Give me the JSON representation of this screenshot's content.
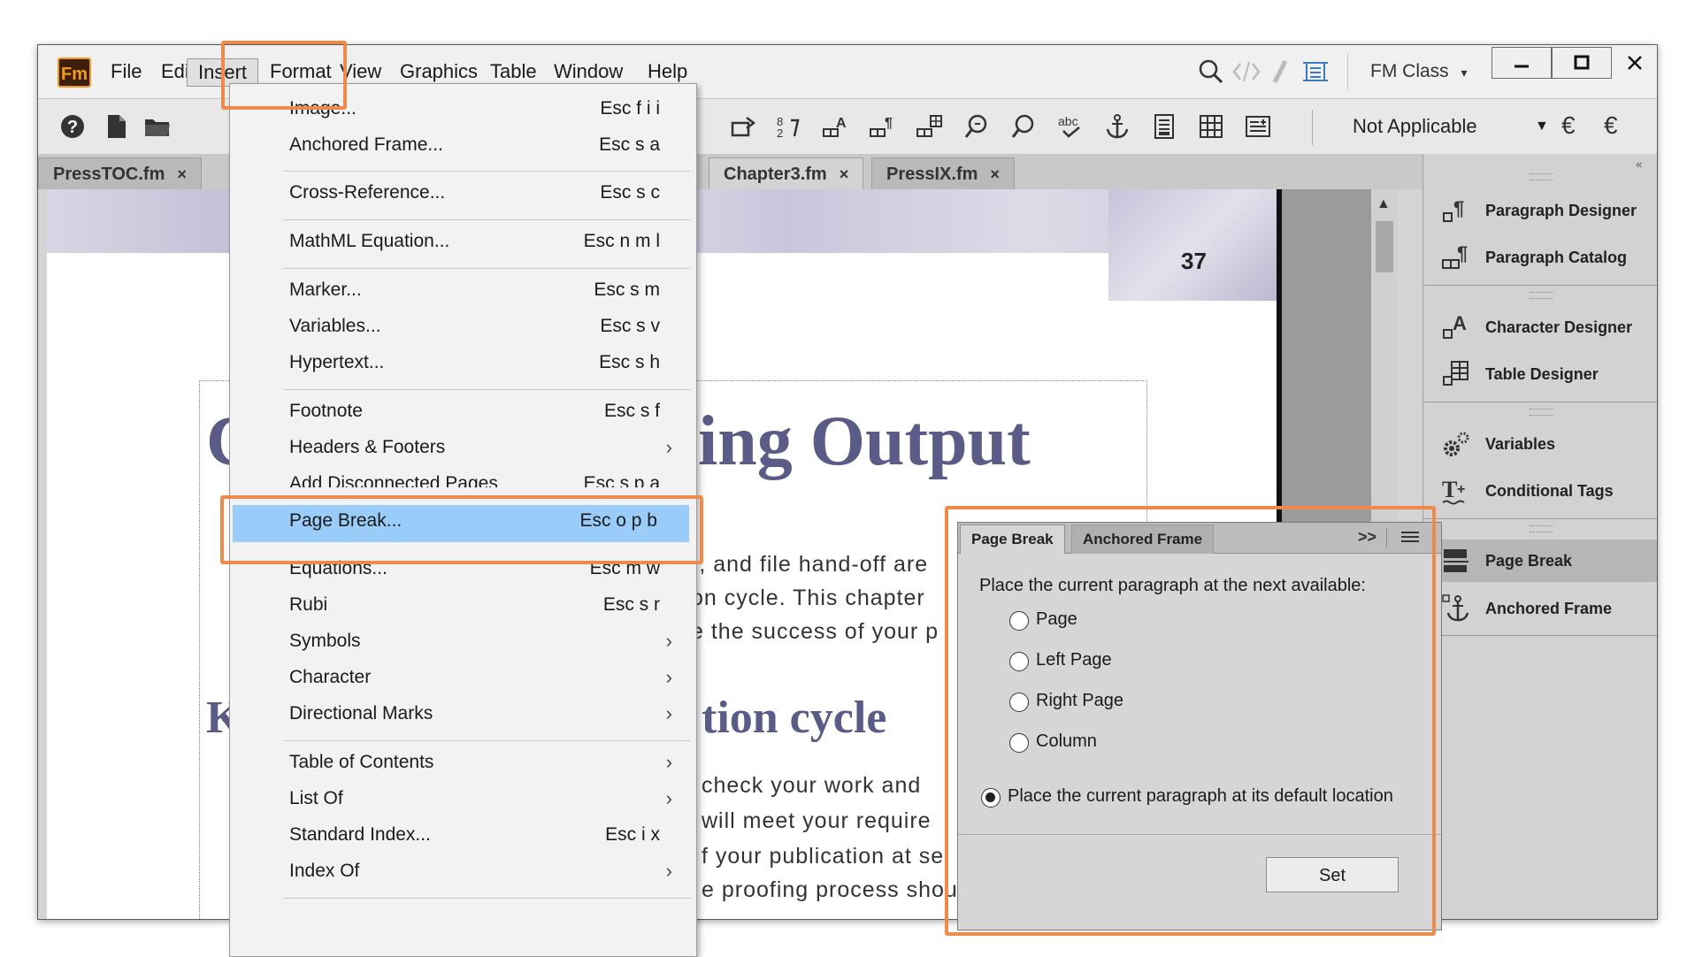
{
  "app": {
    "logo": "Fm",
    "menu": [
      "File",
      "Edit",
      "Insert",
      "Format",
      "View",
      "Graphics",
      "Table",
      "Window",
      "Help"
    ],
    "workspace_label": "FM Class",
    "window_controls": [
      "minimize",
      "maximize",
      "close"
    ]
  },
  "toolbar": {
    "para_tag_select": "Not Applicable",
    "icons": [
      "help-icon",
      "new-document-icon",
      "open-folder-icon",
      "rotate-icon",
      "change-bars-icon",
      "paragraph-designer-icon",
      "paragraph-catalog-icon",
      "character-catalog-icon",
      "find-icon",
      "search-icon",
      "spellcheck-icon",
      "anchor-icon",
      "page-icon",
      "table-icon",
      "format-icon"
    ]
  },
  "tabs": [
    {
      "label": "PressTOC.fm",
      "close": "×"
    },
    {
      "label": "Chapter3.fm",
      "close": "×"
    },
    {
      "label": "PressIX.fm",
      "close": "×"
    }
  ],
  "document": {
    "page_number": "37",
    "heading_left_fragment": "C",
    "heading_right_fragment": "ing Output",
    "body_lines": [
      "), and file hand-off are",
      "on cycle. This chapter",
      "e the success of your p"
    ],
    "heading2_left_fragment": "K",
    "heading2_right_fragment": "tion cycle",
    "body_lines2": [
      "check your work and",
      "will meet your require",
      "f your publication at se",
      "e proofing process shou"
    ]
  },
  "insert_menu": {
    "items": [
      {
        "label": "Image...",
        "shortcut": "Esc f i i"
      },
      {
        "label": "Anchored Frame...",
        "shortcut": "Esc s a"
      },
      {
        "label": "Cross-Reference...",
        "shortcut": "Esc s c"
      },
      {
        "label": "MathML Equation...",
        "shortcut": "Esc n m l"
      },
      {
        "label": "Marker...",
        "shortcut": "Esc s m"
      },
      {
        "label": "Variables...",
        "shortcut": "Esc s v"
      },
      {
        "label": "Hypertext...",
        "shortcut": "Esc s h"
      },
      {
        "label": "Footnote",
        "shortcut": "Esc s f"
      },
      {
        "label": "Headers & Footers",
        "shortcut": ""
      },
      {
        "label": "Add Disconnected Pages",
        "shortcut": "Esc s p a"
      },
      {
        "label": "Page Break...",
        "shortcut": "Esc o p b"
      },
      {
        "label": "Equations...",
        "shortcut": "Esc m w"
      },
      {
        "label": "Rubi",
        "shortcut": "Esc s r"
      },
      {
        "label": "Symbols",
        "shortcut": ""
      },
      {
        "label": "Character",
        "shortcut": ""
      },
      {
        "label": "Directional Marks",
        "shortcut": ""
      },
      {
        "label": "Table of Contents",
        "shortcut": ""
      },
      {
        "label": "List Of",
        "shortcut": ""
      },
      {
        "label": "Standard Index...",
        "shortcut": "Esc i x"
      },
      {
        "label": "Index Of",
        "shortcut": ""
      }
    ],
    "submenu_arrow": "›"
  },
  "right_panel": {
    "items": [
      {
        "label": "Paragraph Designer",
        "icon": "paragraph-designer-icon"
      },
      {
        "label": "Paragraph Catalog",
        "icon": "paragraph-catalog-icon"
      },
      {
        "label": "Character Designer",
        "icon": "character-designer-icon"
      },
      {
        "label": "Table Designer",
        "icon": "table-designer-icon"
      },
      {
        "label": "Variables",
        "icon": "variables-gear-icon"
      },
      {
        "label": "Conditional Tags",
        "icon": "conditional-tags-icon"
      },
      {
        "label": "Page Break",
        "icon": "page-break-icon"
      },
      {
        "label": "Anchored Frame",
        "icon": "anchor-icon"
      }
    ],
    "selected": "Page Break"
  },
  "page_break_dialog": {
    "tabs": [
      "Page Break",
      "Anchored Frame"
    ],
    "overflow_glyph": ">>",
    "prompt": "Place the current paragraph at the next available:",
    "options": [
      "Page",
      "Left Page",
      "Right Page",
      "Column"
    ],
    "default_option": "Place the current paragraph at its default location",
    "selected": "default",
    "set_label": "Set"
  },
  "colors": {
    "callout": "#ee8a4a",
    "menu_highlight": "#99ccf8",
    "heading": "#5a5b86"
  }
}
